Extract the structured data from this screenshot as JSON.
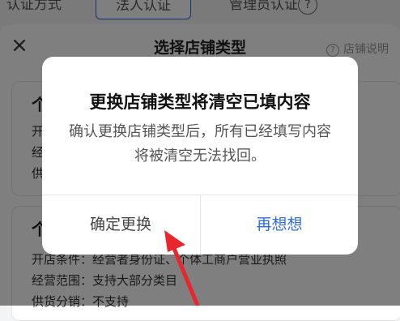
{
  "tabs": {
    "auth_method": "认证方式",
    "legal_person": "法人认证",
    "admin": "管理员认证",
    "help_glyph": "?"
  },
  "sheet": {
    "close_glyph": "×",
    "title": "选择店铺类型",
    "help_label": "店铺说明",
    "help_icon": "question-circle-icon"
  },
  "card1": {
    "heading": "个",
    "line1": "开",
    "line2": "经",
    "line3": "供"
  },
  "card2": {
    "heading": "个",
    "line1": "开店条件：经营者身份证、个体工商户营业执照",
    "line2": "经营范围：支持大部分类目",
    "line3": "供货分销：不支持"
  },
  "dialog": {
    "title": "更换店铺类型将清空已填内容",
    "message": "确认更换店铺类型后，所有已经填写内容将被清空无法找回。",
    "confirm_label": "确定更换",
    "cancel_label": "再想想"
  },
  "colors": {
    "accent": "#2f6be0",
    "annotation_arrow": "#e8262d"
  }
}
